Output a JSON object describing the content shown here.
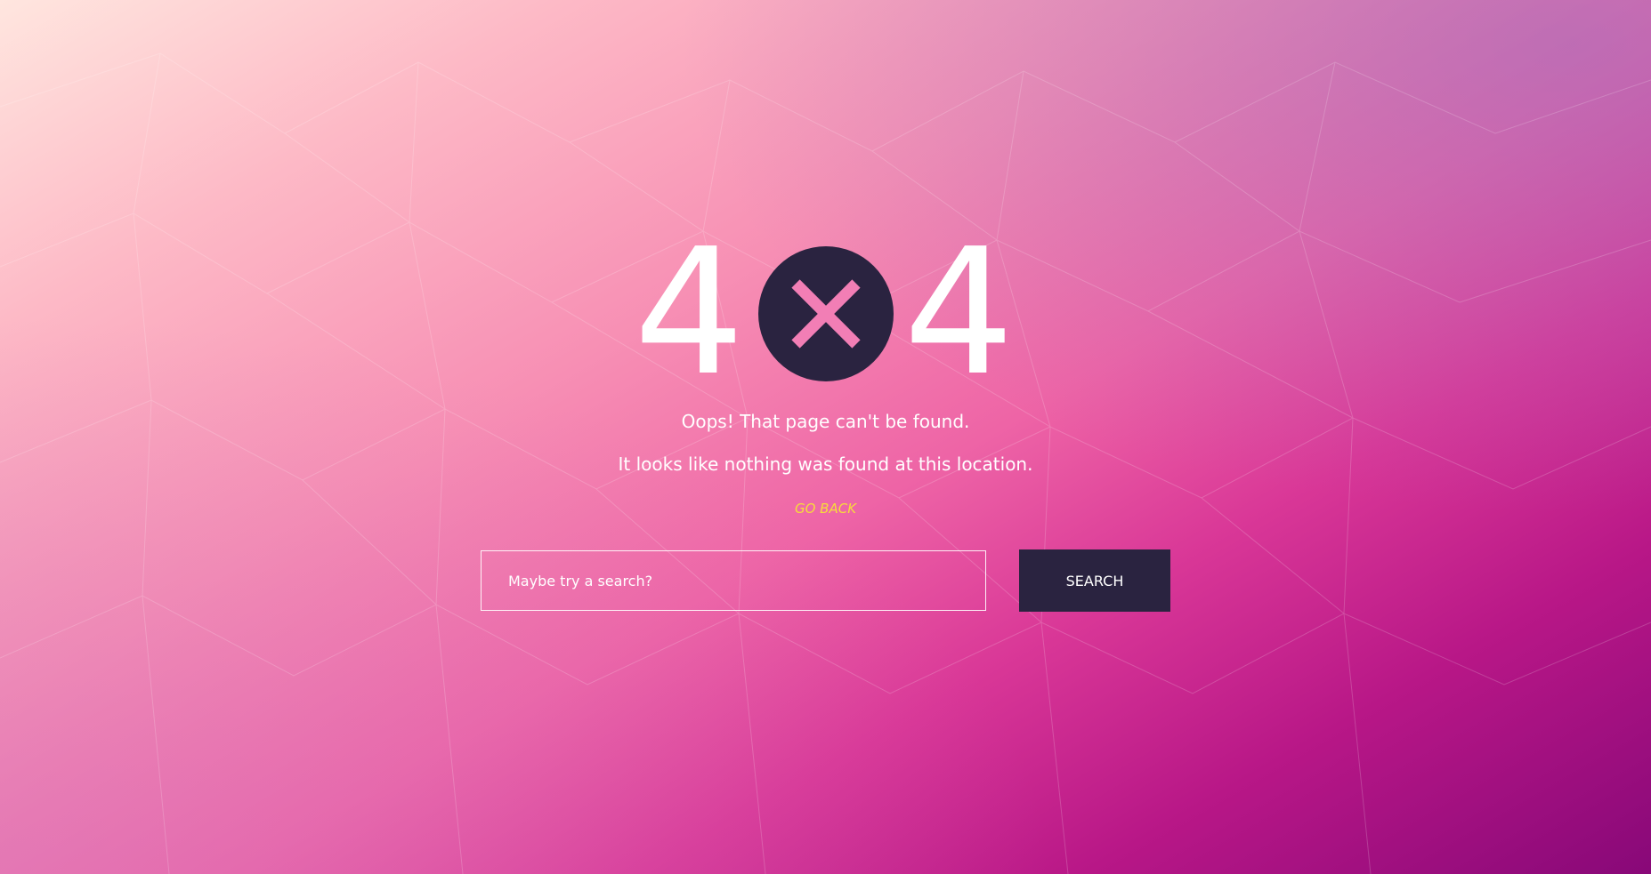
{
  "error": {
    "digit_left": "4",
    "digit_right": "4",
    "badge_icon": "close-icon",
    "badge_color": "#2a2340",
    "cross_color": "#f27eb5"
  },
  "message": {
    "title": "Oops! That page can't be found.",
    "subtitle": "It looks like nothing was found at this location."
  },
  "go_back": {
    "label": "GO BACK",
    "color": "#f7dc3a"
  },
  "search": {
    "placeholder": "Maybe try a search?",
    "value": "",
    "button_label": "SEARCH"
  },
  "colors": {
    "background_start": "#ffe6df",
    "background_mid": "#ee64a6",
    "background_end": "#880878",
    "button_background": "#2a2340"
  }
}
